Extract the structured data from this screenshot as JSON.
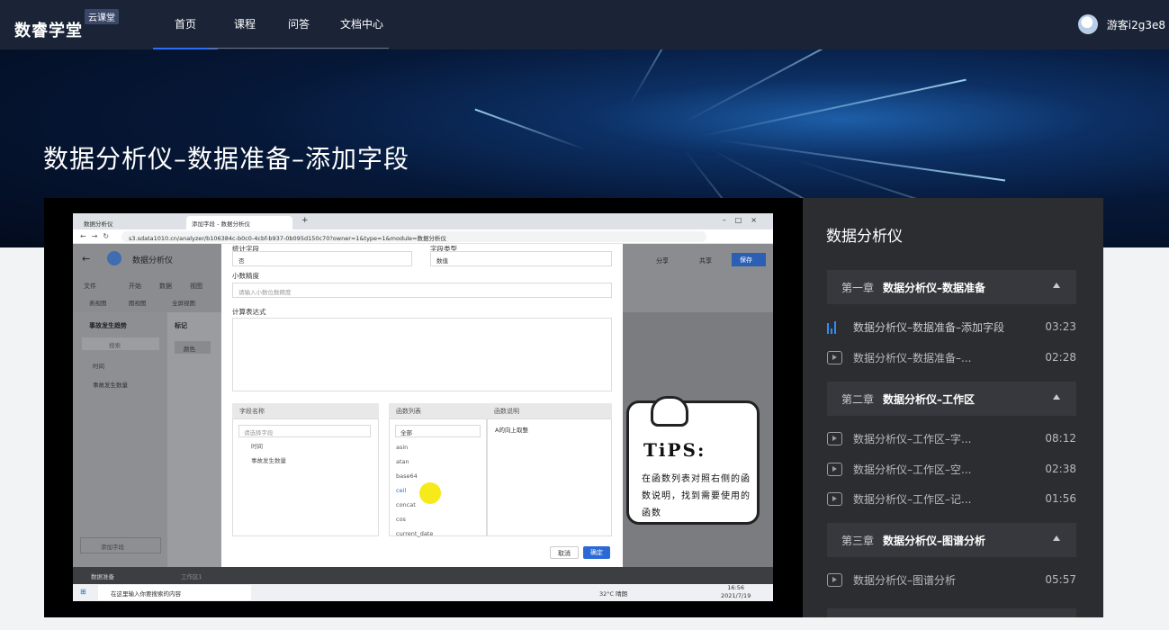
{
  "header": {
    "logo": "数睿学堂",
    "logo_badge": "云课堂",
    "nav": [
      {
        "label": "首页",
        "active": true
      },
      {
        "label": "课程",
        "active": false
      },
      {
        "label": "问答",
        "active": false
      },
      {
        "label": "文档中心",
        "active": false
      }
    ],
    "username": "游客i2g3e8"
  },
  "hero": {
    "title": "数据分析仪–数据准备–添加字段"
  },
  "video": {
    "tabs": [
      "数据分析仪",
      "添加字段 - 数据分析仪"
    ],
    "url": "s3.sdata1010.cn/analyzer/b106384c-b0c0-4cbf-b937-0b095d150c70?owner=1&type=1&module=数据分析仪",
    "app_title": "数据分析仪",
    "app_menu": [
      "文件",
      "开始",
      "数据",
      "视图"
    ],
    "app_toolbar": [
      "表视图",
      "图视图",
      "全屏视图"
    ],
    "share_label": "分享",
    "collab_label": "共享",
    "save_label": "保存",
    "dataset_name": "事故发生趋势",
    "search_placeholder": "搜索",
    "fields": [
      "时间",
      "事故发生数量"
    ],
    "mark_label": "标记",
    "color_label": "颜色",
    "add_field_label": "添加字段",
    "dialog": {
      "stat_label": "统计字段",
      "stat_value": "否",
      "type_label": "字段类型",
      "type_value": "数值",
      "precision_label": "小数精度",
      "precision_placeholder": "请输入小数位数精度",
      "expr_label": "计算表达式",
      "field_name_header": "字段名称",
      "field_search_placeholder": "请选择字段",
      "func_list_header": "函数列表",
      "func_category": "全部",
      "functions": [
        "asin",
        "atan",
        "base64",
        "ceil",
        "concat",
        "cos",
        "current_date"
      ],
      "func_desc_header": "函数说明",
      "func_desc": "A的向上取整",
      "cancel_label": "取消",
      "ok_label": "确定"
    },
    "footer_left": "数据准备",
    "footer_tab": "工作区1",
    "taskbar_search": "在这里输入你要搜索的内容",
    "weather": "32°C 晴朗",
    "time": "16:56",
    "date": "2021/7/19",
    "tips_title": "TiPS:",
    "tips_text": "在函数列表对照右侧的函数说明，找到需要使用的函数"
  },
  "sidebar": {
    "title": "数据分析仪",
    "chapters": [
      {
        "num": "第一章",
        "name": "数据分析仪–数据准备",
        "lessons": [
          {
            "title": "数据分析仪–数据准备–添加字段",
            "duration": "03:23",
            "active": true
          },
          {
            "title": "数据分析仪–数据准备–...",
            "duration": "02:28",
            "active": false
          }
        ]
      },
      {
        "num": "第二章",
        "name": "数据分析仪–工作区",
        "lessons": [
          {
            "title": "数据分析仪–工作区–字...",
            "duration": "08:12",
            "active": false
          },
          {
            "title": "数据分析仪–工作区–空...",
            "duration": "02:38",
            "active": false
          },
          {
            "title": "数据分析仪–工作区–记...",
            "duration": "01:56",
            "active": false
          }
        ]
      },
      {
        "num": "第三章",
        "name": "数据分析仪–图谱分析",
        "lessons": [
          {
            "title": "数据分析仪–图谱分析",
            "duration": "05:57",
            "active": false
          }
        ]
      }
    ]
  }
}
